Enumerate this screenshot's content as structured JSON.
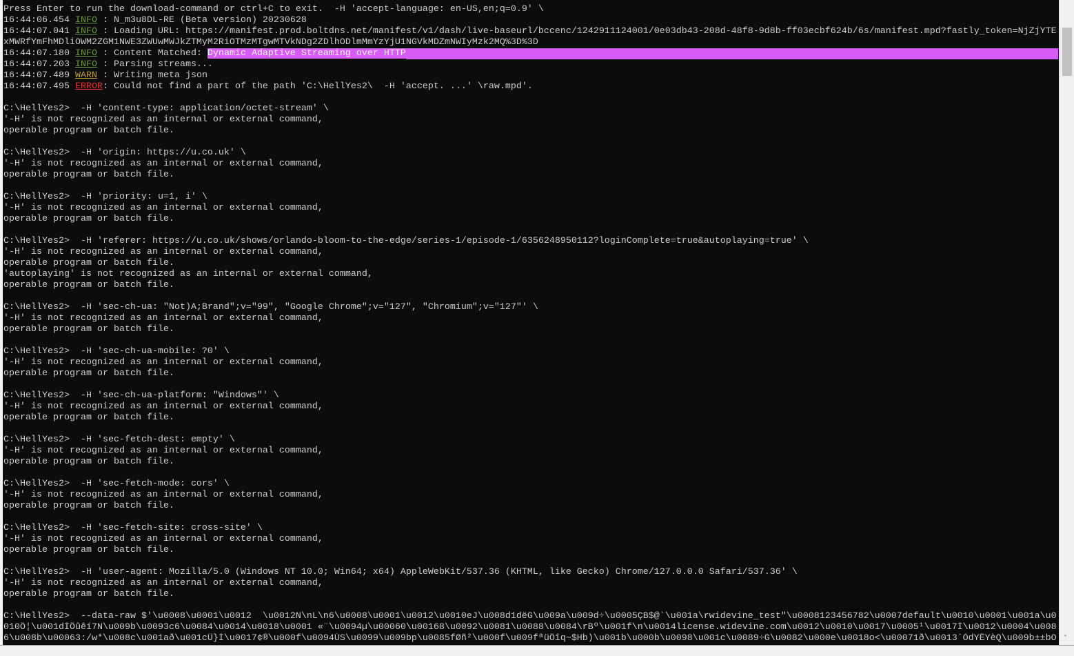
{
  "console": {
    "lines": [
      [
        {
          "t": "Press Enter to run the download-command or ctrl+C to exit.  -H 'accept-language: en-US,en;q=0.9' \\"
        }
      ],
      [
        {
          "t": "16:44:06.454 "
        },
        {
          "t": "INFO",
          "c": "info"
        },
        {
          "t": " : N_m3u8DL-RE (Beta version) 20230628"
        }
      ],
      [
        {
          "t": "16:44:07.041 "
        },
        {
          "t": "INFO",
          "c": "info"
        },
        {
          "t": " : Loading URL: https://manifest.prod.boltdns.net/manifest/v1/dash/live-baseurl/bccenc/1242911124001/0e03db43-208d-48f8-9d8b-ff03ecbf624b/6s/manifest.mpd?fastly_token=NjZjYTE"
        }
      ],
      [
        {
          "t": "xMWRfYmFhMDliOWM2ZGM1NWE3ZWUwMWJkZTMyM2RiOTMzMTgwMTVkNDg2ZDlhODlmMmYzYjU1NGVkMDZmNWIyMzk2MQ%3D%3D"
        }
      ],
      [
        {
          "t": "16:44:07.180 "
        },
        {
          "t": "INFO",
          "c": "info"
        },
        {
          "t": " : Content Matched: "
        },
        {
          "t": "Dynamic Adaptive Streaming over HTTP",
          "c": "hl",
          "fill": true
        }
      ],
      [
        {
          "t": "16:44:07.203 "
        },
        {
          "t": "INFO",
          "c": "info"
        },
        {
          "t": " : Parsing streams..."
        }
      ],
      [
        {
          "t": "16:44:07.489 "
        },
        {
          "t": "WARN",
          "c": "warn"
        },
        {
          "t": " : Writing meta json"
        }
      ],
      [
        {
          "t": "16:44:07.495 "
        },
        {
          "t": "ERROR",
          "c": "error"
        },
        {
          "t": ": Could not find a part of the path 'C:\\HellYes2\\  -H 'accept. ...' \\raw.mpd'."
        }
      ],
      [
        {
          "t": ""
        }
      ],
      [
        {
          "t": "C:\\HellYes2>  -H 'content-type: application/octet-stream' \\"
        }
      ],
      [
        {
          "t": "'-H' is not recognized as an internal or external command,"
        }
      ],
      [
        {
          "t": "operable program or batch file."
        }
      ],
      [
        {
          "t": ""
        }
      ],
      [
        {
          "t": "C:\\HellYes2>  -H 'origin: https://u.co.uk' \\"
        }
      ],
      [
        {
          "t": "'-H' is not recognized as an internal or external command,"
        }
      ],
      [
        {
          "t": "operable program or batch file."
        }
      ],
      [
        {
          "t": ""
        }
      ],
      [
        {
          "t": "C:\\HellYes2>  -H 'priority: u=1, i' \\"
        }
      ],
      [
        {
          "t": "'-H' is not recognized as an internal or external command,"
        }
      ],
      [
        {
          "t": "operable program or batch file."
        }
      ],
      [
        {
          "t": ""
        }
      ],
      [
        {
          "t": "C:\\HellYes2>  -H 'referer: https://u.co.uk/shows/orlando-bloom-to-the-edge/series-1/episode-1/6356248950112?loginComplete=true&autoplaying=true' \\"
        }
      ],
      [
        {
          "t": "'-H' is not recognized as an internal or external command,"
        }
      ],
      [
        {
          "t": "operable program or batch file."
        }
      ],
      [
        {
          "t": "'autoplaying' is not recognized as an internal or external command,"
        }
      ],
      [
        {
          "t": "operable program or batch file."
        }
      ],
      [
        {
          "t": ""
        }
      ],
      [
        {
          "t": "C:\\HellYes2>  -H 'sec-ch-ua: \"Not)A;Brand\";v=\"99\", \"Google Chrome\";v=\"127\", \"Chromium\";v=\"127\"' \\"
        }
      ],
      [
        {
          "t": "'-H' is not recognized as an internal or external command,"
        }
      ],
      [
        {
          "t": "operable program or batch file."
        }
      ],
      [
        {
          "t": ""
        }
      ],
      [
        {
          "t": "C:\\HellYes2>  -H 'sec-ch-ua-mobile: ?0' \\"
        }
      ],
      [
        {
          "t": "'-H' is not recognized as an internal or external command,"
        }
      ],
      [
        {
          "t": "operable program or batch file."
        }
      ],
      [
        {
          "t": ""
        }
      ],
      [
        {
          "t": "C:\\HellYes2>  -H 'sec-ch-ua-platform: \"Windows\"' \\"
        }
      ],
      [
        {
          "t": "'-H' is not recognized as an internal or external command,"
        }
      ],
      [
        {
          "t": "operable program or batch file."
        }
      ],
      [
        {
          "t": ""
        }
      ],
      [
        {
          "t": "C:\\HellYes2>  -H 'sec-fetch-dest: empty' \\"
        }
      ],
      [
        {
          "t": "'-H' is not recognized as an internal or external command,"
        }
      ],
      [
        {
          "t": "operable program or batch file."
        }
      ],
      [
        {
          "t": ""
        }
      ],
      [
        {
          "t": "C:\\HellYes2>  -H 'sec-fetch-mode: cors' \\"
        }
      ],
      [
        {
          "t": "'-H' is not recognized as an internal or external command,"
        }
      ],
      [
        {
          "t": "operable program or batch file."
        }
      ],
      [
        {
          "t": ""
        }
      ],
      [
        {
          "t": "C:\\HellYes2>  -H 'sec-fetch-site: cross-site' \\"
        }
      ],
      [
        {
          "t": "'-H' is not recognized as an internal or external command,"
        }
      ],
      [
        {
          "t": "operable program or batch file."
        }
      ],
      [
        {
          "t": ""
        }
      ],
      [
        {
          "t": "C:\\HellYes2>  -H 'user-agent: Mozilla/5.0 (Windows NT 10.0; Win64; x64) AppleWebKit/537.36 (KHTML, like Gecko) Chrome/127.0.0.0 Safari/537.36' \\"
        }
      ],
      [
        {
          "t": "'-H' is not recognized as an internal or external command,"
        }
      ],
      [
        {
          "t": "operable program or batch file."
        }
      ],
      [
        {
          "t": ""
        }
      ],
      [
        {
          "t": "C:\\HellYes2>  --data-raw $'\\u0008\\u0001\\u0012  \\u0012N\\nL\\n6\\u0008\\u0001\\u0012\\u0010eJ\\u008d1dëG\\u009a\\u009d÷\\u0005ÇB$@`\\u001a\\rwidevine_test\"\\u0008123456782\\u0007default\\u0010\\u0001\\u001a\\u0"
        }
      ],
      [
        {
          "t": "010Ö¦\\u001dÍÔûêí7N\\u009b\\u0093c6\\u0084\\u0014\\u0018\\u0001 «¨\\u0094µ\\u00060\\u00168\\u0092\\u0081\\u0088\\u0084\\rBº\\u001f\\n\\u0014license.widevine.com\\u0012\\u0010\\u0017\\u0005¹\\u0017Ì\\u0012\\u0004\\u008"
        }
      ],
      [
        {
          "t": "6\\u008b\\u00063:/w*\\u008c\\u001að\\u001cÜ}Ì\\u0017¢®\\u000f\\u0094ÚS\\u0099\\u009bp\\u0085fØñ²\\u000f\\u009fªüÖîq~$Hb)\\u001b\\u000b\\u0098\\u001c\\u0089÷G\\u0082\\u000e\\u0018o<\\u00071ð\\u0013´ÒdYÊYèQ\\u009b±±bO"
        }
      ]
    ]
  },
  "scrollbar": {
    "down_arrow": "˅"
  },
  "colors": {
    "background": "#0c0c0c",
    "text": "#cccccc",
    "info": "#6a9b3c",
    "warn": "#c6a227",
    "error": "#e83030",
    "highlight": "#d65cf5"
  }
}
